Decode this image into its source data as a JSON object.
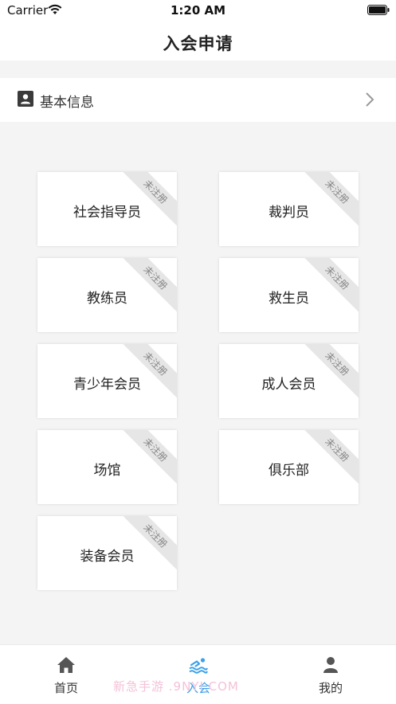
{
  "status": {
    "carrier": "Carrier",
    "time": "1:20 AM",
    "wifi_icon": "wifi-icon",
    "battery_icon": "battery-icon"
  },
  "nav": {
    "title": "入会申请"
  },
  "info": {
    "label": "基本信息",
    "icon": "id-card-icon",
    "chevron": "chevron-right-icon"
  },
  "cards": [
    {
      "label": "社会指导员",
      "badge": "未注册"
    },
    {
      "label": "裁判员",
      "badge": "未注册"
    },
    {
      "label": "教练员",
      "badge": "未注册"
    },
    {
      "label": "救生员",
      "badge": "未注册"
    },
    {
      "label": "青少年会员",
      "badge": "未注册"
    },
    {
      "label": "成人会员",
      "badge": "未注册"
    },
    {
      "label": "场馆",
      "badge": "未注册"
    },
    {
      "label": "俱乐部",
      "badge": "未注册"
    },
    {
      "label": "装备会员",
      "badge": "未注册"
    }
  ],
  "tabs": [
    {
      "label": "首页",
      "icon": "home-icon",
      "active": false
    },
    {
      "label": "入会",
      "icon": "swimmer-icon",
      "active": true
    },
    {
      "label": "我的",
      "icon": "person-icon",
      "active": false
    }
  ],
  "watermark": "新急手游 .9NYI.COM",
  "colors": {
    "accent": "#3aa0e8",
    "background": "#f4f4f4",
    "card": "#ffffff",
    "badge": "#e6e6e6"
  }
}
